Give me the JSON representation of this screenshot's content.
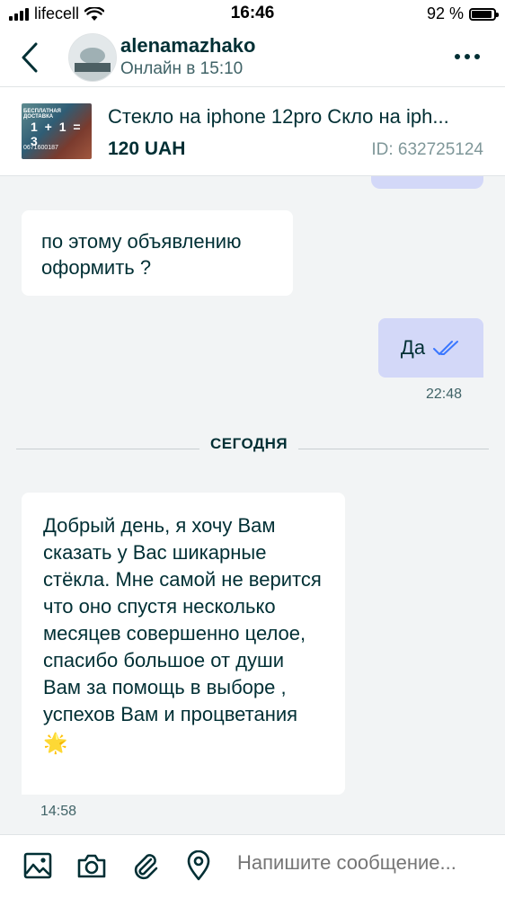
{
  "status_bar": {
    "carrier": "lifecell",
    "time": "16:46",
    "battery": "92 %"
  },
  "header": {
    "username": "alenamazhako",
    "status": "Онлайн в 15:10"
  },
  "ad": {
    "title": "Стекло на iphone 12pro Скло на iph...",
    "price": "120 UAH",
    "id": "ID: 632725124",
    "thumb_text": {
      "top": "БЕСПЛАТНАЯ ДОСТАВКА",
      "middle": "1 + 1 = 3",
      "bottom": "0671600187"
    }
  },
  "messages": [
    {
      "direction": "incoming",
      "text": "по этому объявлению оформить ?"
    },
    {
      "direction": "outgoing",
      "text": "Да",
      "time": "22:48",
      "status_icon": "double-check-icon"
    },
    {
      "direction": "incoming",
      "text": "Добрый день, я хочу Вам сказать у Вас шикарные стёкла. Мне самой не верится что оно спустя несколько месяцев совершенно целое, спасибо большое от души Вам за помощь в выборе , успехов Вам и процветания",
      "emoji": "🌟",
      "time": "14:58"
    }
  ],
  "date_divider": "СЕГОДНЯ",
  "composer": {
    "placeholder": "Напишите сообщение...",
    "icons": [
      "image-icon",
      "camera-icon",
      "attachment-icon",
      "location-icon"
    ]
  },
  "colors": {
    "primary": "#002f34",
    "outgoing_bubble": "#d3d8f8",
    "background": "#f2f4f5",
    "check": "#3a77ff"
  }
}
